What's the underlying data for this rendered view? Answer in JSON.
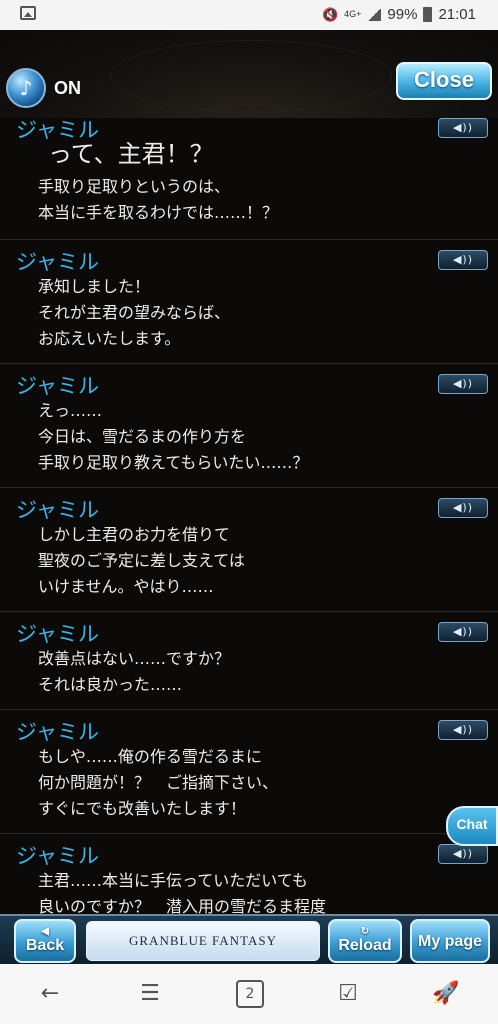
{
  "status_bar": {
    "battery": "99%",
    "time": "21:01",
    "network": "4G+"
  },
  "header": {
    "sound_state": "ON",
    "close_label": "Close"
  },
  "entries": [
    {
      "speaker": "ジャミル",
      "voice": "◀))",
      "lines": [
        "って、主君！？",
        "手取り足取りというのは、",
        "本当に手を取るわけでは……！？"
      ]
    },
    {
      "speaker": "ジャミル",
      "voice": "◀))",
      "lines": [
        "承知しました！",
        "それが主君の望みならば、",
        "お応えいたします。"
      ]
    },
    {
      "speaker": "ジャミル",
      "voice": "◀))",
      "lines": [
        "えっ……",
        "今日は、雪だるまの作り方を",
        "手取り足取り教えてもらいたい……？"
      ]
    },
    {
      "speaker": "ジャミル",
      "voice": "◀))",
      "lines": [
        "しかし主君のお力を借りて",
        "聖夜のご予定に差し支えては",
        "いけません。やはり……"
      ]
    },
    {
      "speaker": "ジャミル",
      "voice": "◀))",
      "lines": [
        "改善点はない……ですか？",
        "それは良かった……"
      ]
    },
    {
      "speaker": "ジャミル",
      "voice": "◀))",
      "lines": [
        "もしや……俺の作る雪だるまに",
        "何か問題が！？　ご指摘下さい、",
        "すぐにでも改善いたします！"
      ]
    },
    {
      "speaker": "ジャミル",
      "voice": "◀))",
      "lines": [
        "主君……本当に手伝っていただいても",
        "良いのですか？　潜入用の雪だるま程度"
      ]
    }
  ],
  "chat_label": "Chat",
  "game_nav": {
    "back_label": "Back",
    "reload_label": "Reload",
    "mypage_label": "My page",
    "logo_text": "GRANBLUE FANTASY"
  },
  "android_nav": {
    "back": "←",
    "menu": "☰",
    "tabs": "2",
    "check": "☑",
    "rocket": "🚀"
  }
}
